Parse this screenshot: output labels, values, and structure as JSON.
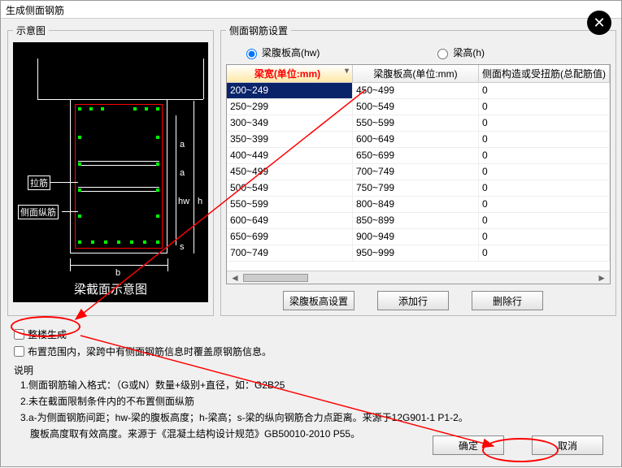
{
  "title": "生成侧面钢筋",
  "panels": {
    "left": "示意图",
    "right": "侧面钢筋设置"
  },
  "diagram": {
    "caption": "梁截面示意图",
    "label_lajin": "拉筋",
    "label_cemian": "侧面纵筋",
    "dim_a": "a",
    "dim_hw": "hw",
    "dim_h": "h",
    "dim_s": "s",
    "dim_b": "b"
  },
  "radios": {
    "hw": "梁腹板高(hw)",
    "h": "梁高(h)"
  },
  "grid": {
    "headers": {
      "col1": "梁宽(单位:mm)",
      "col2": "梁腹板高(单位:mm)",
      "col3": "侧面构造或受扭筋(总配筋值)"
    },
    "rows": [
      {
        "c1": "200~249",
        "c2": "450~499",
        "c3": "0",
        "sel": true
      },
      {
        "c1": "250~299",
        "c2": "500~549",
        "c3": "0"
      },
      {
        "c1": "300~349",
        "c2": "550~599",
        "c3": "0"
      },
      {
        "c1": "350~399",
        "c2": "600~649",
        "c3": "0"
      },
      {
        "c1": "400~449",
        "c2": "650~699",
        "c3": "0"
      },
      {
        "c1": "450~499",
        "c2": "700~749",
        "c3": "0"
      },
      {
        "c1": "500~549",
        "c2": "750~799",
        "c3": "0"
      },
      {
        "c1": "550~599",
        "c2": "800~849",
        "c3": "0"
      },
      {
        "c1": "600~649",
        "c2": "850~899",
        "c3": "0"
      },
      {
        "c1": "650~699",
        "c2": "900~949",
        "c3": "0"
      },
      {
        "c1": "700~749",
        "c2": "950~999",
        "c3": "0"
      }
    ]
  },
  "buttons": {
    "fubanSetting": "梁腹板高设置",
    "addRow": "添加行",
    "delRow": "删除行",
    "ok": "确定",
    "cancel": "取消"
  },
  "checks": {
    "wholeBuilding": "整楼生成",
    "overwrite": "布置范围内，梁跨中有侧面钢筋信息时覆盖原钢筋信息。"
  },
  "desc": {
    "head": "说明",
    "l1": "1.侧面钢筋输入格式：（G或N）数量+级别+直径，如：G2B25",
    "l2": "2.未在截面限制条件内的不布置侧面纵筋",
    "l3": "3.a-为侧面钢筋间距；hw-梁的腹板高度；h-梁高；s-梁的纵向钢筋合力点距离。来源于12G901-1 P1-2。",
    "l4": "　腹板高度取有效高度。来源于《混凝土结构设计规范》GB50010-2010 P55。"
  }
}
